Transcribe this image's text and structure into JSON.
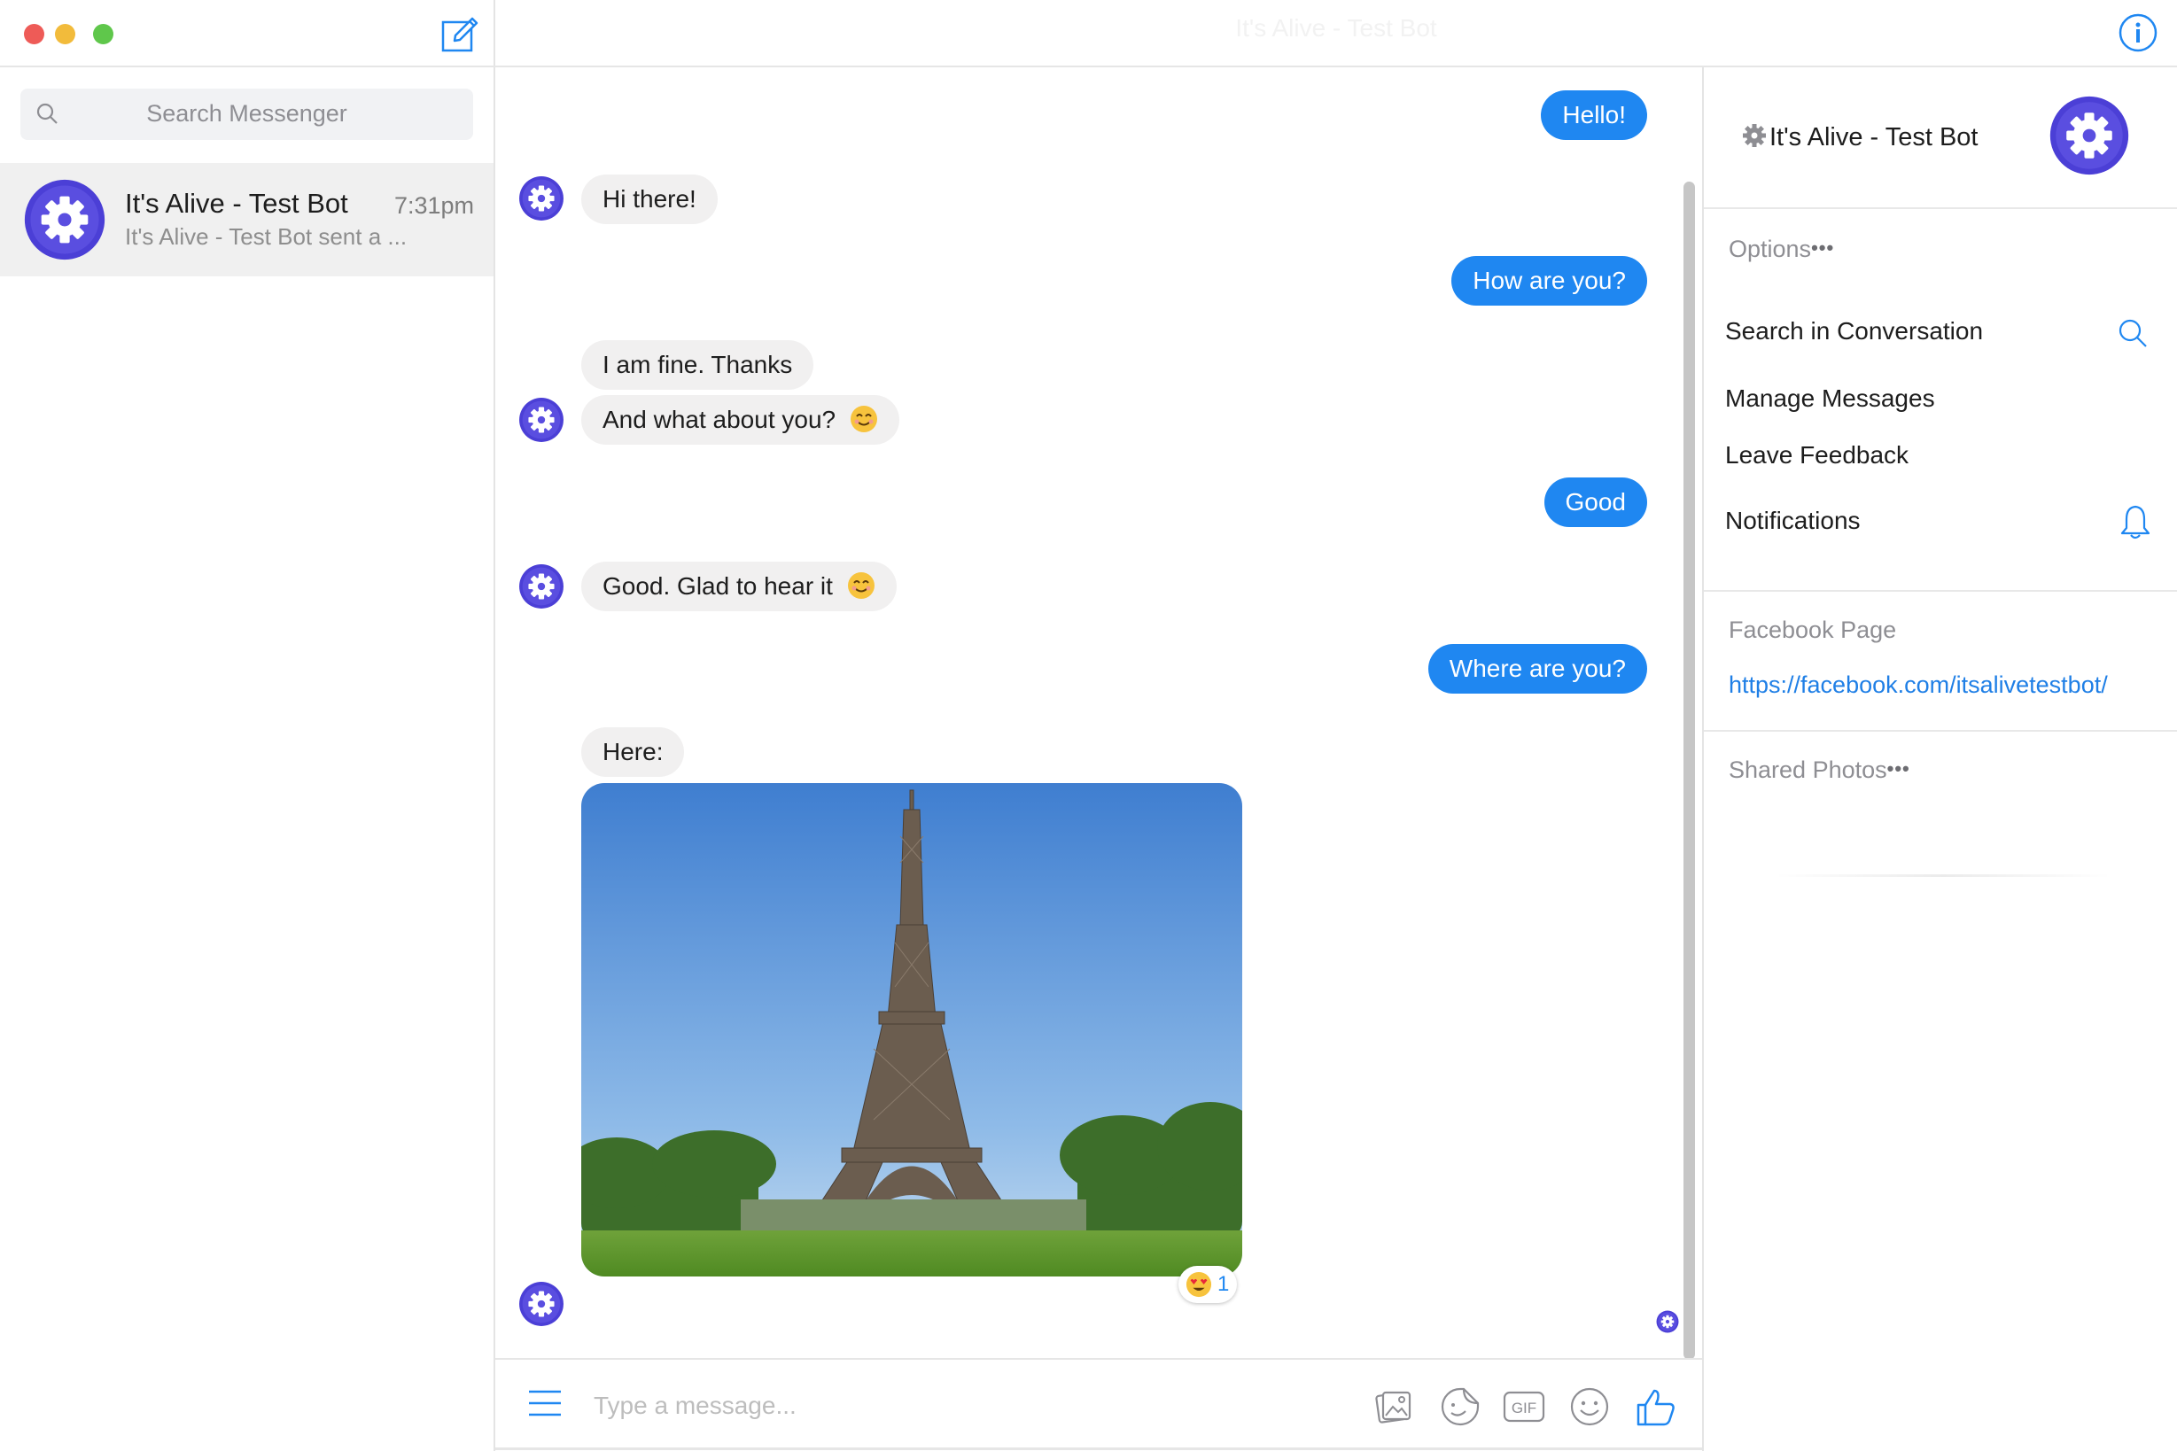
{
  "window": {
    "title": "It's Alive - Test Bot"
  },
  "sidebar": {
    "search_placeholder": "Search Messenger",
    "conversations": [
      {
        "name": "It's Alive - Test Bot",
        "time": "7:31pm",
        "preview": "It's Alive - Test Bot sent a ..."
      }
    ]
  },
  "chat": {
    "messages": [
      {
        "from": "me",
        "text": "Hello!"
      },
      {
        "from": "bot",
        "text": "Hi there!"
      },
      {
        "from": "me",
        "text": "How are you?"
      },
      {
        "from": "bot",
        "text": "I am fine. Thanks"
      },
      {
        "from": "bot",
        "text": "And what about you?"
      },
      {
        "from": "me",
        "text": "Good"
      },
      {
        "from": "bot",
        "text": "Good. Glad to hear it"
      },
      {
        "from": "me",
        "text": "Where are you?"
      },
      {
        "from": "bot",
        "text": "Here:"
      }
    ],
    "photo_reaction": {
      "emoji": "heart-eyes-emoji",
      "count": "1"
    }
  },
  "composer": {
    "placeholder": "Type a message...",
    "tools": [
      "photo-icon",
      "sticker-icon",
      "gif-icon",
      "emoji-icon",
      "thumbs-up-icon"
    ]
  },
  "right_panel": {
    "name": "It's Alive - Test Bot",
    "options_label": "Options",
    "options": [
      "Search in Conversation",
      "Manage Messages",
      "Leave Feedback",
      "Notifications"
    ],
    "facebook_page_label": "Facebook Page",
    "facebook_page_url": "https://facebook.com/itsalivetestbot/",
    "shared_photos_label": "Shared Photos"
  },
  "colors": {
    "accent": "#1f87f1",
    "bot_avatar": "#4b3fd6",
    "incoming_bubble": "#f1f0f0"
  }
}
